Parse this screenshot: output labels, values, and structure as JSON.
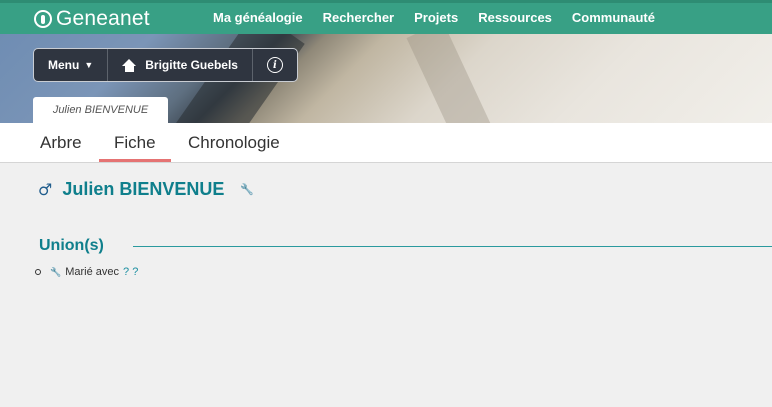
{
  "brand": {
    "name": "Geneanet"
  },
  "nav": {
    "links": [
      "Ma généalogie",
      "Rechercher",
      "Projets",
      "Ressources",
      "Communauté"
    ]
  },
  "toolbar": {
    "menu_label": "Menu",
    "home_label": "Brigitte Guebels"
  },
  "person_tab": "Julien BIENVENUE",
  "subtabs": {
    "arbre": "Arbre",
    "fiche": "Fiche",
    "chronologie": "Chronologie",
    "active": "Fiche"
  },
  "person": {
    "gender_symbol": "♂",
    "name": "Julien BIENVENUE"
  },
  "unions": {
    "title": "Union(s)",
    "items": [
      {
        "label": "Marié avec",
        "spouse": "? ?"
      }
    ]
  },
  "colors": {
    "nav_bg": "#38a085",
    "accent_teal": "#0f7f8c",
    "active_tab_underline": "#e57373",
    "toolbar_bg": "#2f3540"
  }
}
